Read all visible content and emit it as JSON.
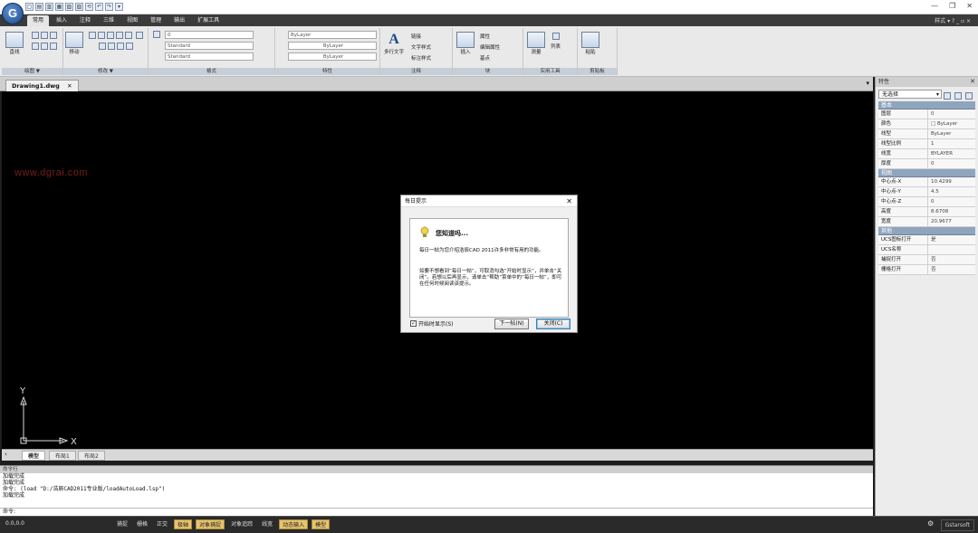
{
  "app": {
    "logo_letter": "G"
  },
  "qat": {
    "buttons": [
      "▢",
      "▤",
      "▥",
      "▦",
      "▧",
      "▨",
      "⟲",
      "↶",
      "↷",
      "▾"
    ]
  },
  "window_controls": {
    "minimize": "—",
    "restore": "❐",
    "close": "✕"
  },
  "ribbon_tabs": [
    "常用",
    "插入",
    "注释",
    "三维",
    "视图",
    "管理",
    "输出",
    "扩展工具"
  ],
  "style_label": "样式 ▾ ? _ ▫ ×",
  "ribbon": {
    "draw": {
      "title": "绘图 ▼",
      "line_label": "直线"
    },
    "modify": {
      "title": "修改 ▼",
      "move_label": "移动"
    },
    "layers": {
      "combo1": "0",
      "combo2": "Standard",
      "combo3": "Standard"
    },
    "format": {
      "title": "格式"
    },
    "properties": {
      "title": "特性",
      "color": "ByLayer",
      "linetype": "ByLayer",
      "lineweight": "ByLayer"
    },
    "annotation": {
      "title": "注释",
      "mtext_label": "多行文字",
      "link": "链接",
      "text_style": "文字样式",
      "dim_style": "标注样式"
    },
    "block": {
      "title": "块",
      "insert_label": "插入",
      "attribute": "属性",
      "edit_attr": "编辑属性",
      "base_point": "基点"
    },
    "utilities": {
      "title": "实用工具",
      "measure_label": "测量",
      "list_label": "列表"
    },
    "clipboard": {
      "title": "剪贴板",
      "paste_label": "粘贴"
    }
  },
  "document": {
    "tab": "Drawing1.dwg",
    "tab_close": "✕",
    "collapse": "▾"
  },
  "watermark": "www.dgrai.com",
  "ucs": {
    "x_label": "X",
    "y_label": "Y"
  },
  "layout_tabs": [
    "模型",
    "布局1",
    "布局2"
  ],
  "command": {
    "header": "命令行",
    "lines": [
      "加载完成",
      "加载完成",
      "命令: (load \"D:/浩辰CAD2011专业版/loadAutoLoad.lsp\")",
      "加载完成"
    ],
    "prompt": "命令:"
  },
  "status": {
    "coords": "0.0,0.0",
    "toggles": [
      {
        "label": "捕捉",
        "on": false
      },
      {
        "label": "栅格",
        "on": false
      },
      {
        "label": "正交",
        "on": false
      },
      {
        "label": "极轴",
        "on": true
      },
      {
        "label": "对象捕捉",
        "on": true
      },
      {
        "label": "对象追踪",
        "on": false
      },
      {
        "label": "线宽",
        "on": false
      },
      {
        "label": "动态输入",
        "on": true
      },
      {
        "label": "模型",
        "on": true
      }
    ],
    "brand": "Gstarsoft"
  },
  "properties_panel": {
    "title": "特性",
    "close": "✕",
    "selection": "无选择",
    "sections": [
      {
        "name": "基本",
        "rows": [
          [
            "图层",
            "0"
          ],
          [
            "颜色",
            "□ ByLayer"
          ],
          [
            "线型",
            "ByLayer"
          ],
          [
            "线型比例",
            "1"
          ],
          [
            "线宽",
            "BYLAYER"
          ],
          [
            "厚度",
            "0"
          ]
        ]
      },
      {
        "name": "视图",
        "rows": [
          [
            "中心点-X",
            "10.4299"
          ],
          [
            "中心点-Y",
            "4.5"
          ],
          [
            "中心点-Z",
            "0"
          ],
          [
            "高度",
            "8.6708"
          ],
          [
            "宽度",
            "20.9677"
          ]
        ]
      },
      {
        "name": "其他",
        "rows": [
          [
            "UCS图标打开",
            "是"
          ],
          [
            "UCS名称",
            ""
          ],
          [
            "捕捉打开",
            "否"
          ],
          [
            "栅格打开",
            "否"
          ]
        ]
      }
    ]
  },
  "dialog": {
    "title": "每日提示",
    "close": "✕",
    "heading": "您知道吗...",
    "para1": "每日一帖为您介绍浩辰CAD 2011许多非常有用的功能。",
    "para2": "如要不想看到“每日一帖”，可取消勾选“开始时显示”，并单击“关闭”。若想以后再显示，请单击“帮助”菜单中的“每日一帖”，即可在任何时候阅读该提示。",
    "show_on_start": "开始时显示(S)",
    "next_tip": "下一帖(N)",
    "close_btn": "关闭(C)"
  }
}
